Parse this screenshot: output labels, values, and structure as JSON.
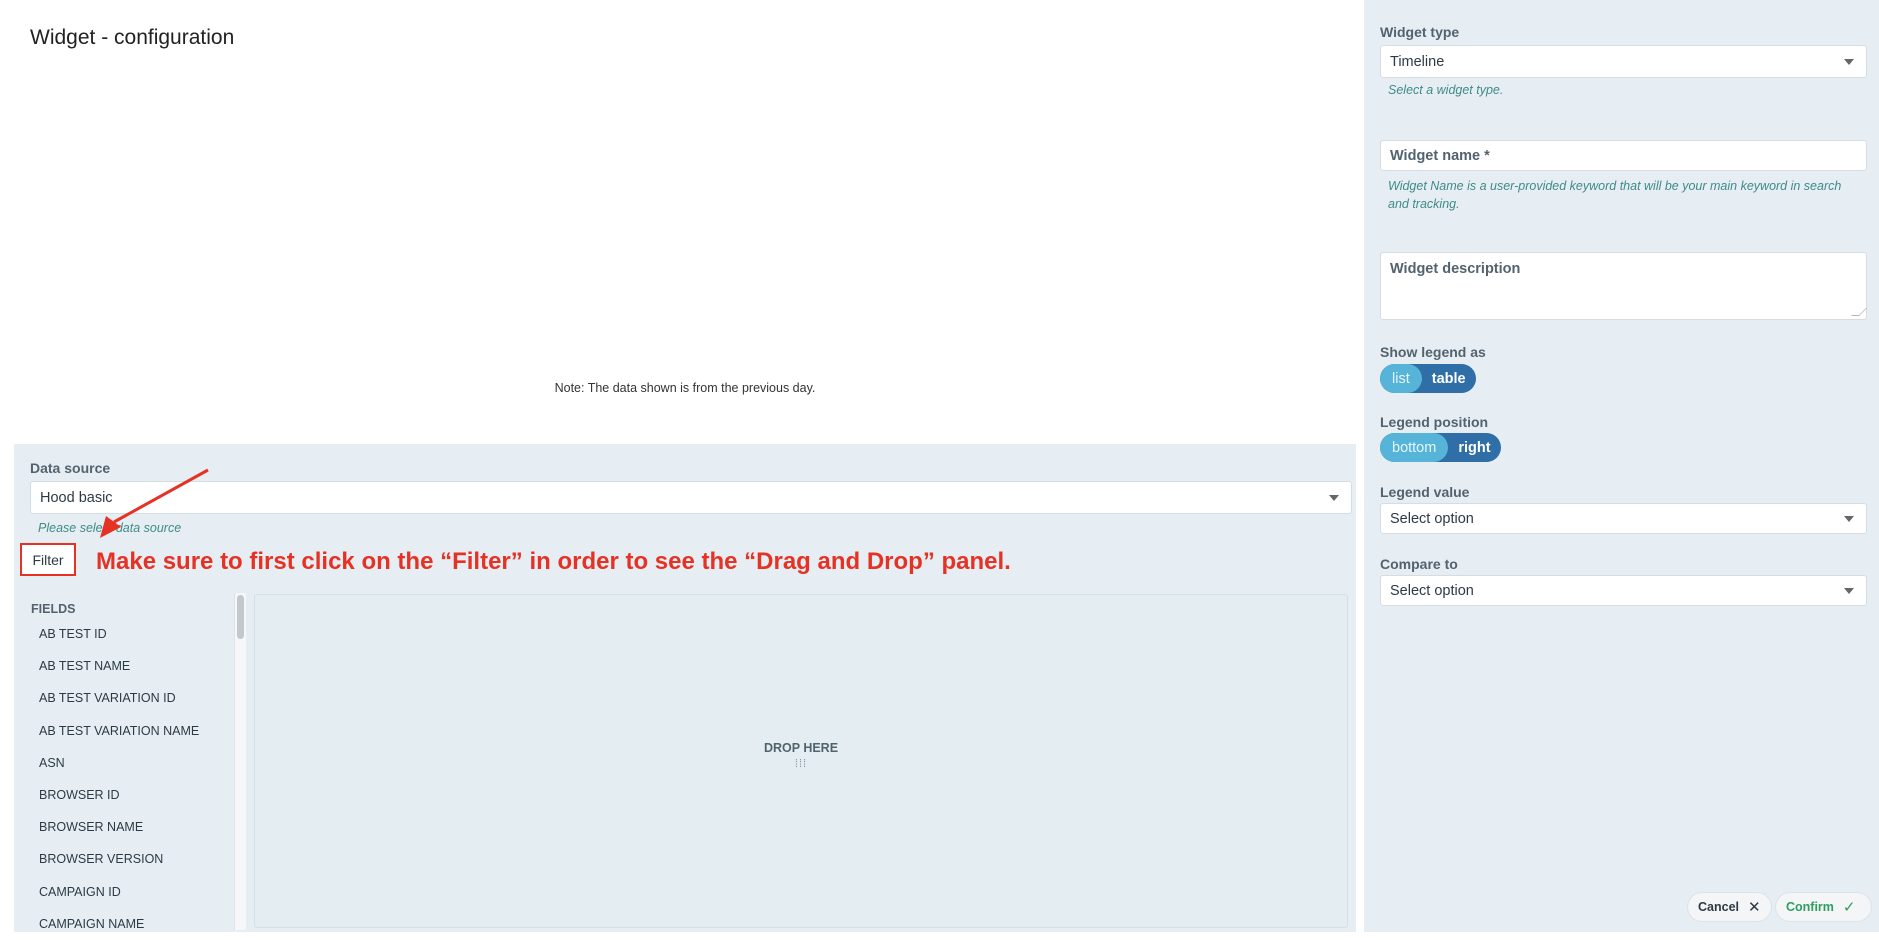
{
  "page": {
    "title": "Widget - configuration",
    "note": "Note: The data shown is from the previous day."
  },
  "data_source": {
    "label": "Data source",
    "value": "Hood basic",
    "helper": "Please select data source"
  },
  "filter": {
    "button_label": "Filter",
    "callout": "Make sure to first click on the “Filter” in order to see the “Drag and Drop” panel."
  },
  "fields": {
    "title": "FIELDS",
    "items": [
      "AB TEST ID",
      "AB TEST NAME",
      "AB TEST VARIATION ID",
      "AB TEST VARIATION NAME",
      "ASN",
      "BROWSER ID",
      "BROWSER NAME",
      "BROWSER VERSION",
      "CAMPAIGN ID",
      "CAMPAIGN NAME"
    ]
  },
  "drop_zone": {
    "label": "DROP HERE",
    "icon": "drag-grip-icon"
  },
  "config": {
    "widget_type": {
      "label": "Widget type",
      "value": "Timeline",
      "helper": "Select a widget type."
    },
    "widget_name": {
      "placeholder": "Widget name *",
      "helper": "Widget Name is a user-provided keyword that will be your main keyword in search and tracking."
    },
    "widget_description": {
      "placeholder": "Widget description"
    },
    "show_legend_as": {
      "label": "Show legend as",
      "options": [
        "list",
        "table"
      ],
      "selected": "list"
    },
    "legend_position": {
      "label": "Legend position",
      "options": [
        "bottom",
        "right"
      ],
      "selected": "bottom"
    },
    "legend_value": {
      "label": "Legend value",
      "value": "Select option"
    },
    "compare_to": {
      "label": "Compare to",
      "value": "Select option"
    }
  },
  "actions": {
    "cancel_label": "Cancel",
    "cancel_icon": "close-icon",
    "confirm_label": "Confirm",
    "confirm_icon": "check-icon"
  },
  "colors": {
    "panel_bg": "#e6eef3",
    "annotation_red": "#e53224",
    "helper_teal": "#3f8b87",
    "toggle_active": "#56b4d8",
    "toggle_base": "#2f6ea6",
    "confirm_green": "#2e9d62"
  }
}
